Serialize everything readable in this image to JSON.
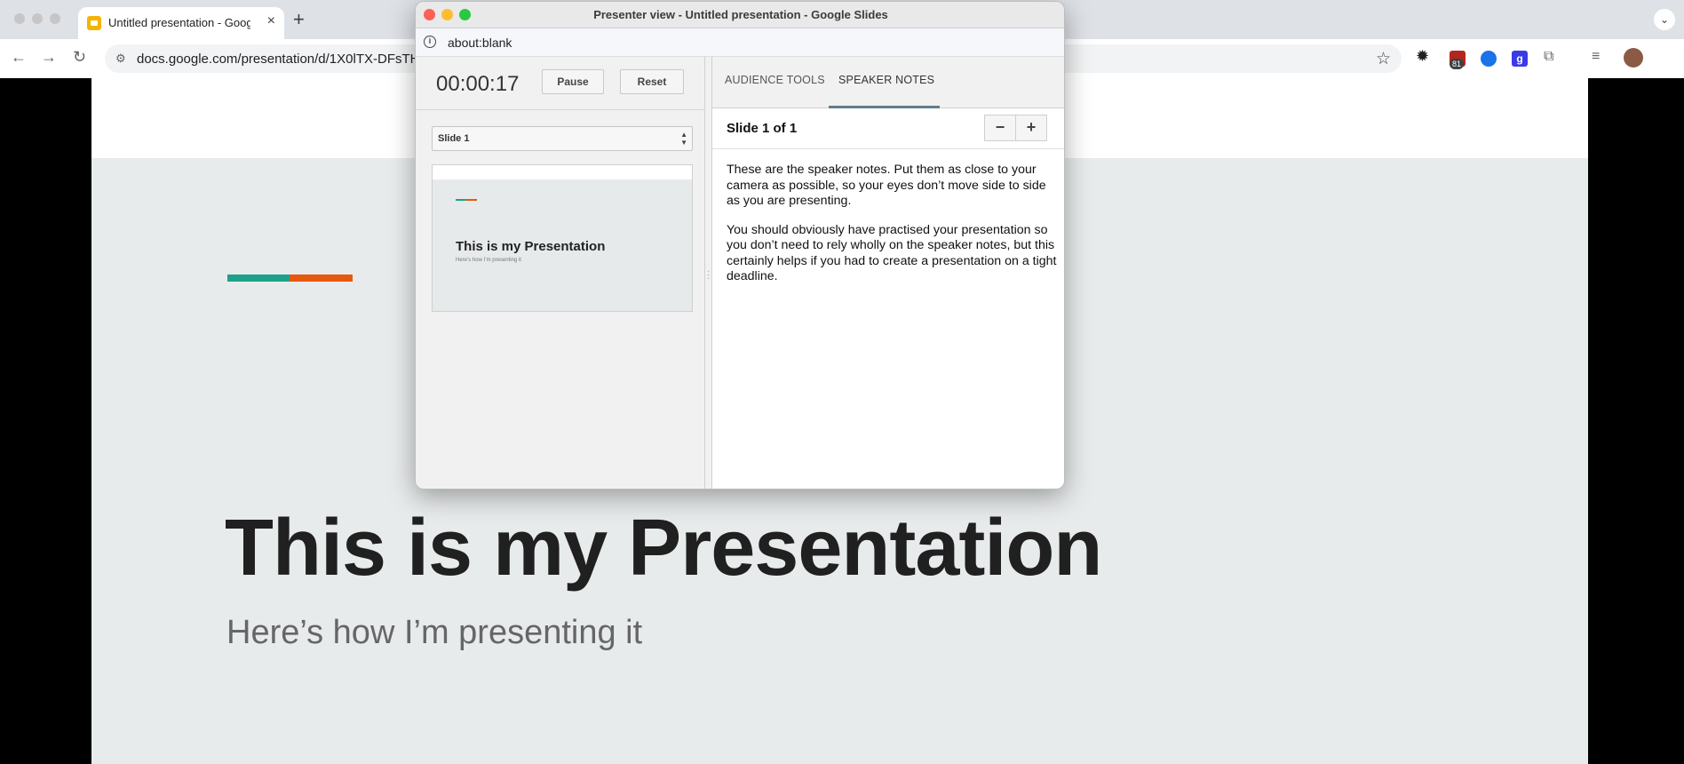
{
  "browser": {
    "tab_title": "Untitled presentation - Google Slides",
    "tab_close": "×",
    "new_tab": "+",
    "tab_search": "⌄",
    "url": "docs.google.com/presentation/d/1X0lTX-DFsTH",
    "ext_badge": "81",
    "ext_g": "g"
  },
  "slide": {
    "title": "This is my Presentation",
    "subtitle": "Here’s how I’m presenting it",
    "accent_colors": [
      "#1fa08a",
      "#e8580c"
    ]
  },
  "presenter": {
    "window_title": "Presenter view - Untitled presentation - Google Slides",
    "url": "about:blank",
    "timer": "00:00:17",
    "pause_label": "Pause",
    "reset_label": "Reset",
    "slide_select": "Slide 1",
    "thumb_title": "This is my Presentation",
    "thumb_subtitle": "Here’s how I’m presenting it",
    "tabs": [
      {
        "label": "AUDIENCE TOOLS",
        "active": false
      },
      {
        "label": "SPEAKER NOTES",
        "active": true
      }
    ],
    "notes_slide_label": "Slide 1 of 1",
    "zoom_out_label": "−",
    "zoom_in_label": "+",
    "notes": [
      "These are the speaker notes. Put them as close to your camera as possible, so your eyes don’t move side to side as you are presenting.",
      "You should obviously have practised your presentation so you don’t need to rely wholly on the speaker notes, but this certainly helps if you had to create a presentation on a tight deadline."
    ]
  }
}
